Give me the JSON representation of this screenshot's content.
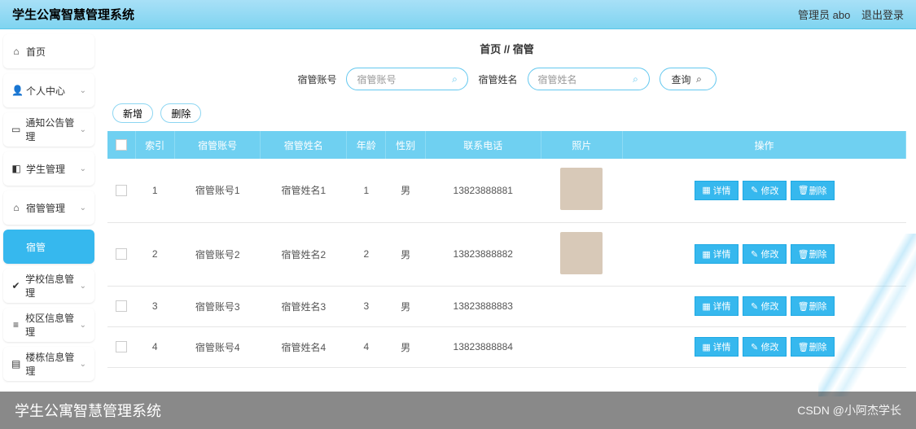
{
  "header": {
    "title": "学生公寓智慧管理系统",
    "admin_label": "管理员 abo",
    "logout_label": "退出登录"
  },
  "sidebar": {
    "items": [
      {
        "icon": "⌂",
        "label": "首页",
        "active": false,
        "hasChev": false
      },
      {
        "icon": "👤",
        "label": "个人中心",
        "active": false,
        "hasChev": true
      },
      {
        "icon": "▭",
        "label": "通知公告管理",
        "active": false,
        "hasChev": true
      },
      {
        "icon": "◧",
        "label": "学生管理",
        "active": false,
        "hasChev": true
      },
      {
        "icon": "⌂",
        "label": "宿管管理",
        "active": false,
        "hasChev": true
      },
      {
        "icon": "",
        "label": "宿管",
        "active": true,
        "hasChev": false
      },
      {
        "icon": "✔",
        "label": "学校信息管理",
        "active": false,
        "hasChev": true
      },
      {
        "icon": "≡",
        "label": "校区信息管理",
        "active": false,
        "hasChev": true
      },
      {
        "icon": "▤",
        "label": "楼栋信息管理",
        "active": false,
        "hasChev": true
      }
    ]
  },
  "breadcrumb": {
    "home": "首页",
    "sep": "//",
    "current": "宿管"
  },
  "search": {
    "field1_label": "宿管账号",
    "field1_placeholder": "宿管账号",
    "field2_label": "宿管姓名",
    "field2_placeholder": "宿管姓名",
    "query_btn": "查询"
  },
  "toolbar": {
    "add": "新增",
    "delete": "删除"
  },
  "table": {
    "headers": [
      "",
      "索引",
      "宿管账号",
      "宿管姓名",
      "年龄",
      "性别",
      "联系电话",
      "照片",
      "操作"
    ],
    "op_labels": {
      "detail": "详情",
      "edit": "修改",
      "delete": "删除"
    },
    "rows": [
      {
        "idx": "1",
        "account": "宿管账号1",
        "name": "宿管姓名1",
        "age": "1",
        "gender": "男",
        "phone": "13823888881",
        "hasPhoto": true,
        "short": false
      },
      {
        "idx": "2",
        "account": "宿管账号2",
        "name": "宿管姓名2",
        "age": "2",
        "gender": "男",
        "phone": "13823888882",
        "hasPhoto": true,
        "short": false
      },
      {
        "idx": "3",
        "account": "宿管账号3",
        "name": "宿管姓名3",
        "age": "3",
        "gender": "男",
        "phone": "13823888883",
        "hasPhoto": false,
        "short": true
      },
      {
        "idx": "4",
        "account": "宿管账号4",
        "name": "宿管姓名4",
        "age": "4",
        "gender": "男",
        "phone": "13823888884",
        "hasPhoto": false,
        "short": true
      }
    ]
  },
  "watermark": {
    "left": "学生公寓智慧管理系统",
    "right": "CSDN @小阿杰学长"
  }
}
